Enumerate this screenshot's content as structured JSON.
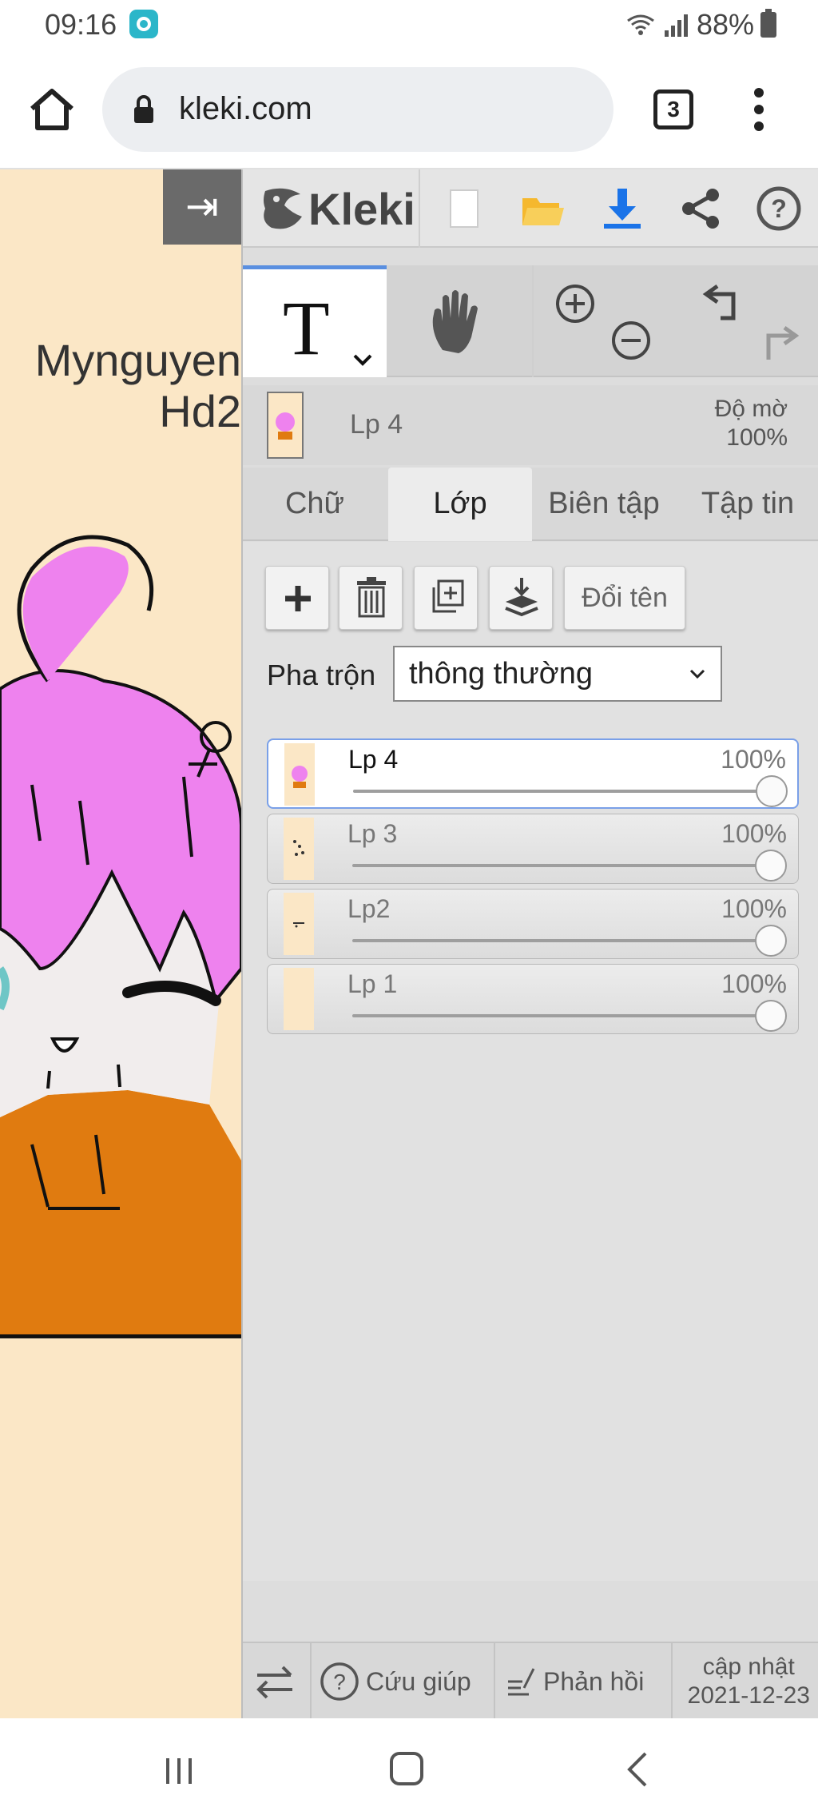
{
  "status_bar": {
    "time": "09:16",
    "battery": "88%"
  },
  "browser": {
    "url": "kleki.com",
    "tab_count": "3"
  },
  "canvas": {
    "line1": "Mynguyen",
    "line2": "Hd2"
  },
  "app": {
    "name": "Kleki"
  },
  "active_layer": {
    "name": "Lp 4",
    "opacity_label": "Độ mờ",
    "opacity_value": "100%"
  },
  "tabs": [
    {
      "label": "Chữ"
    },
    {
      "label": "Lớp"
    },
    {
      "label": "Biên tập"
    },
    {
      "label": "Tập tin"
    }
  ],
  "layer_panel": {
    "rename_label": "Đổi tên",
    "blend_label": "Pha trộn",
    "blend_value": "thông thường",
    "layers": [
      {
        "name": "Lp 4",
        "opacity": "100%",
        "opacity_value": 1.0
      },
      {
        "name": "Lp 3",
        "opacity": "100%",
        "opacity_value": 1.0
      },
      {
        "name": "Lp2",
        "opacity": "100%",
        "opacity_value": 1.0
      },
      {
        "name": "Lp 1",
        "opacity": "100%",
        "opacity_value": 1.0
      }
    ]
  },
  "bottom_bar": {
    "help_label": "Cứu giúp",
    "feedback_label": "Phản hồi",
    "update_label": "cập nhật",
    "update_date": "2021-12-23"
  },
  "colors": {
    "canvas_bg": "#fbe7c6",
    "hair": "#ee82ee",
    "shirt": "#e07b10",
    "accent_blue": "#1a73e8",
    "folder_yellow": "#f5b82e"
  }
}
